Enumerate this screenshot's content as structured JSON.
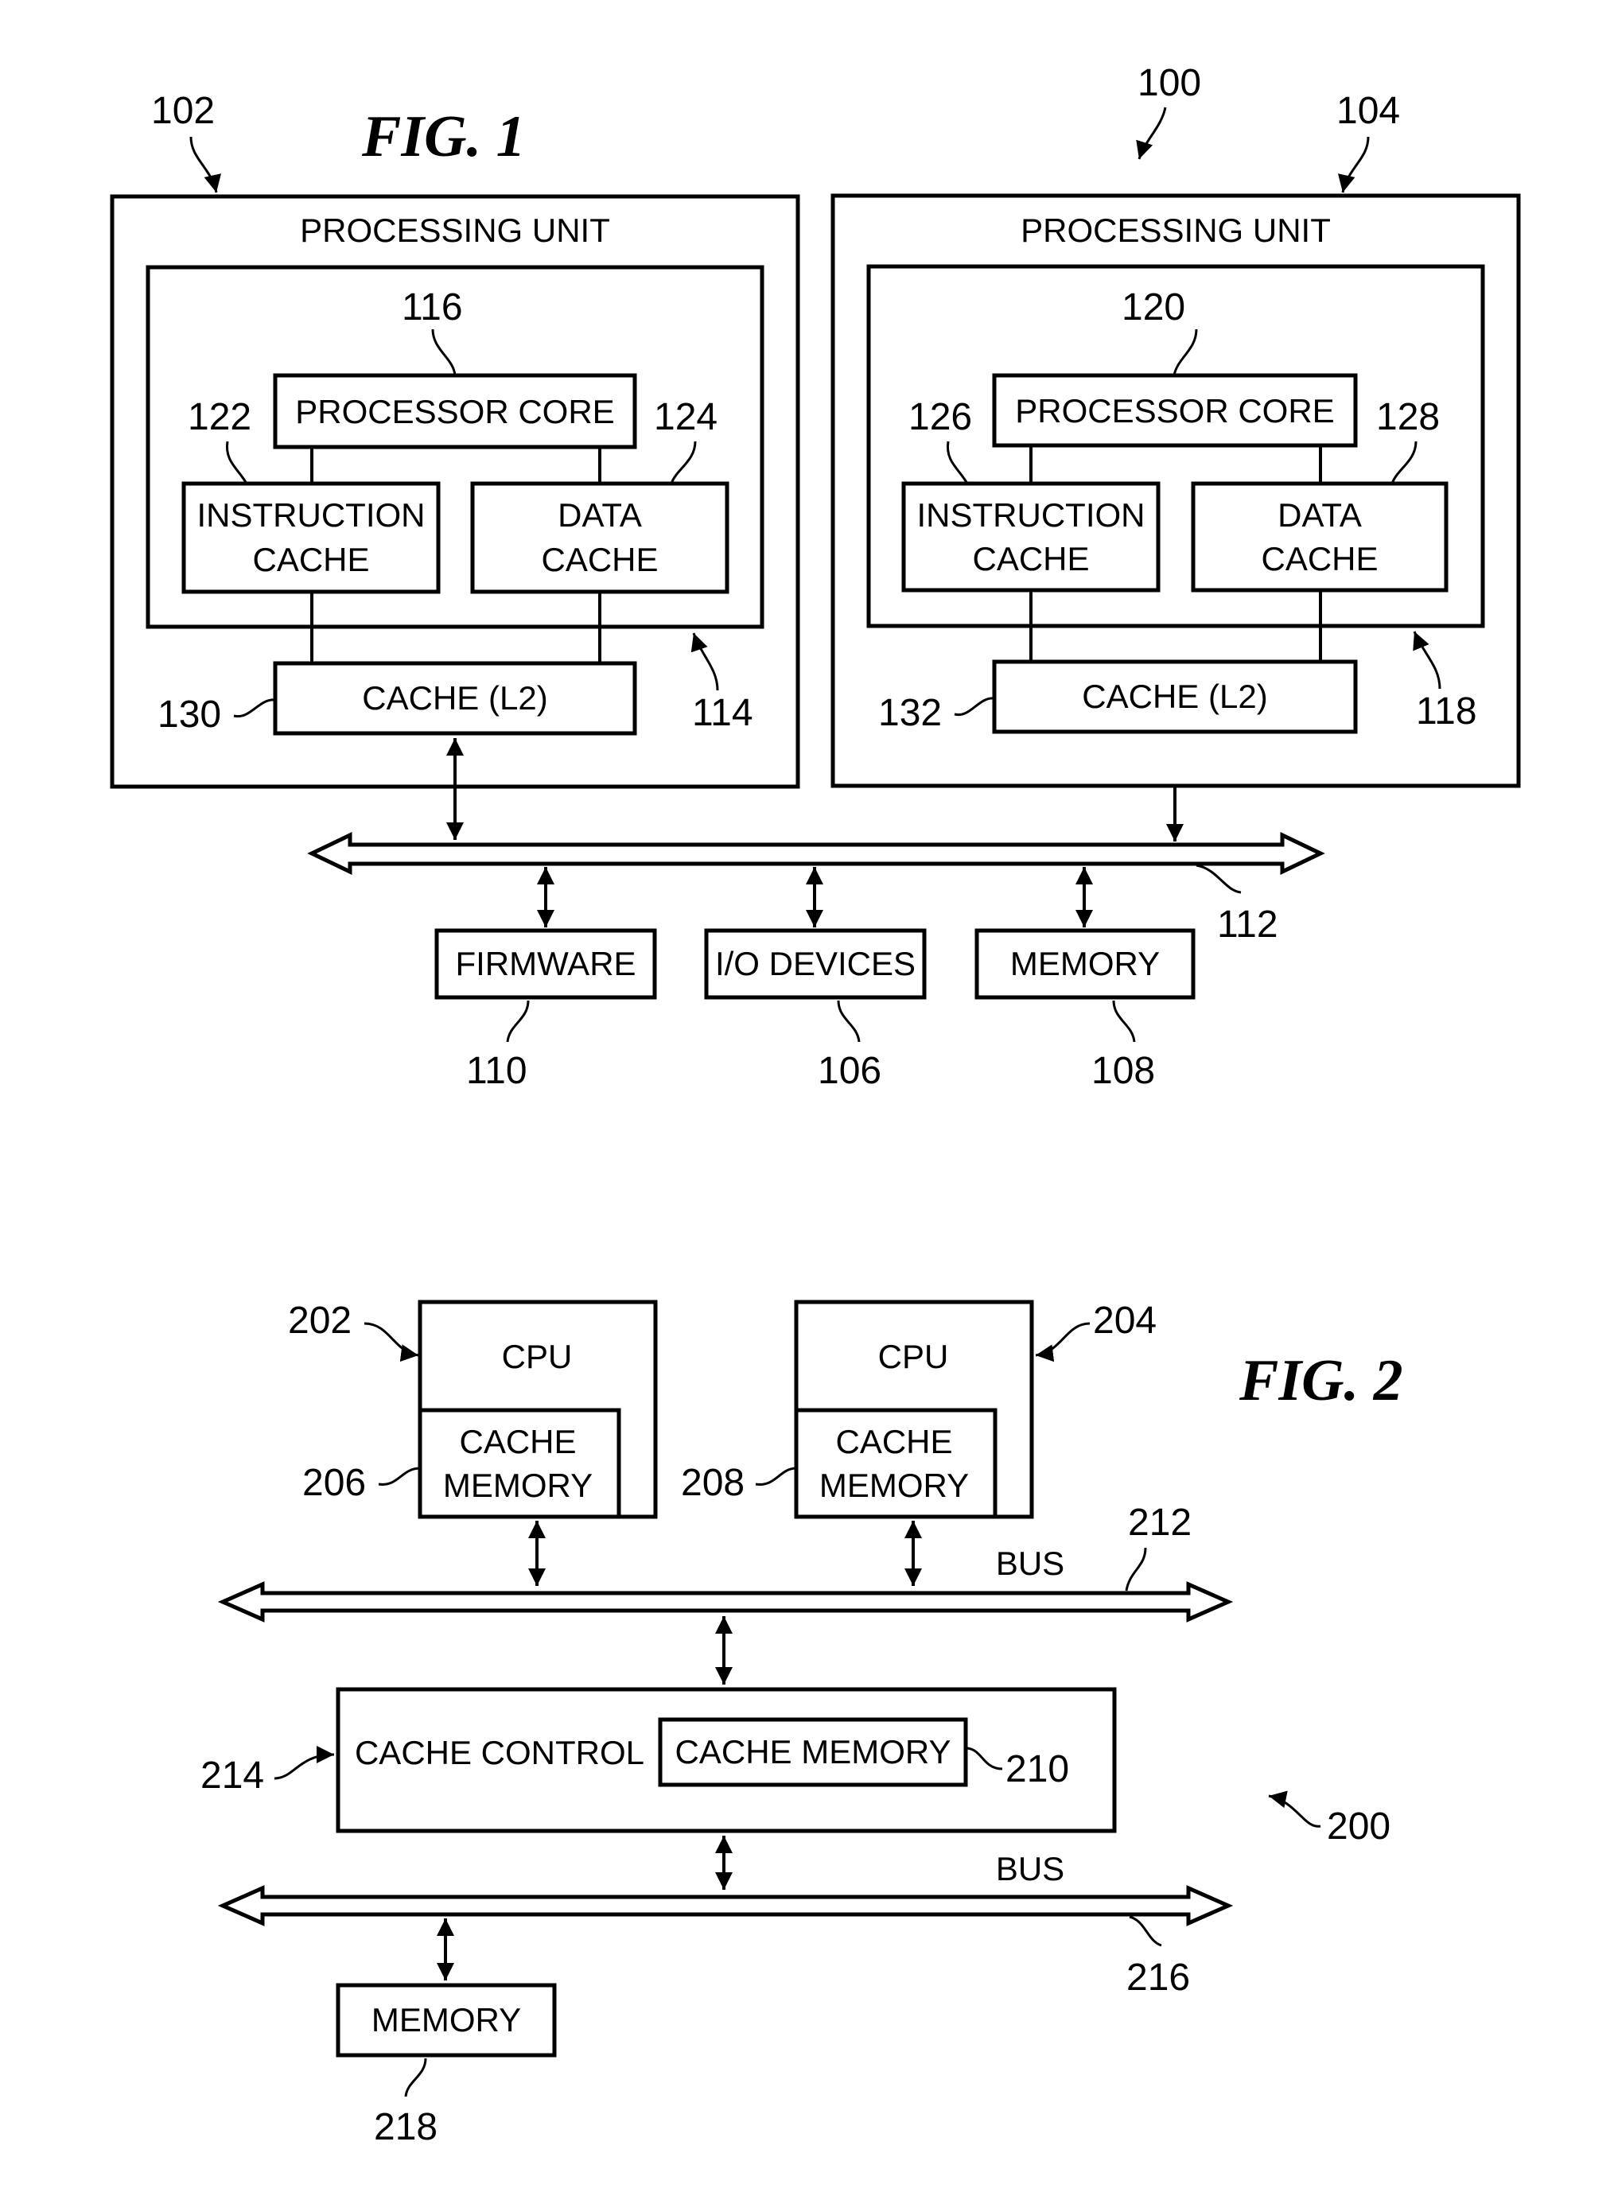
{
  "fig1": {
    "title": "FIG. 1",
    "system_ref": "100",
    "units": [
      {
        "ref": "102",
        "title": "PROCESSING UNIT",
        "core_group_ref": "114",
        "core": {
          "ref": "116",
          "label": "PROCESSOR CORE"
        },
        "icache": {
          "ref": "122",
          "line1": "INSTRUCTION",
          "line2": "CACHE"
        },
        "dcache": {
          "ref": "124",
          "line1": "DATA",
          "line2": "CACHE"
        },
        "l2": {
          "ref": "130",
          "label": "CACHE (L2)"
        }
      },
      {
        "ref": "104",
        "title": "PROCESSING UNIT",
        "core_group_ref": "118",
        "core": {
          "ref": "120",
          "label": "PROCESSOR CORE"
        },
        "icache": {
          "ref": "126",
          "line1": "INSTRUCTION",
          "line2": "CACHE"
        },
        "dcache": {
          "ref": "128",
          "line1": "DATA",
          "line2": "CACHE"
        },
        "l2": {
          "ref": "132",
          "label": "CACHE (L2)"
        }
      }
    ],
    "bus_ref": "112",
    "peripherals": [
      {
        "label": "FIRMWARE",
        "ref": "110"
      },
      {
        "label": "I/O DEVICES",
        "ref": "106"
      },
      {
        "label": "MEMORY",
        "ref": "108"
      }
    ]
  },
  "fig2": {
    "title": "FIG. 2",
    "system_ref": "200",
    "cpus": [
      {
        "ref": "202",
        "label": "CPU",
        "cache_ref": "206",
        "cache_line1": "CACHE",
        "cache_line2": "MEMORY"
      },
      {
        "ref": "204",
        "label": "CPU",
        "cache_ref": "208",
        "cache_line1": "CACHE",
        "cache_line2": "MEMORY"
      }
    ],
    "bus1": {
      "label": "BUS",
      "ref": "212"
    },
    "cache_control": {
      "ref": "214",
      "label": "CACHE CONTROL",
      "memory_label": "CACHE MEMORY",
      "memory_ref": "210"
    },
    "bus2": {
      "label": "BUS",
      "ref": "216"
    },
    "memory": {
      "label": "MEMORY",
      "ref": "218"
    }
  }
}
